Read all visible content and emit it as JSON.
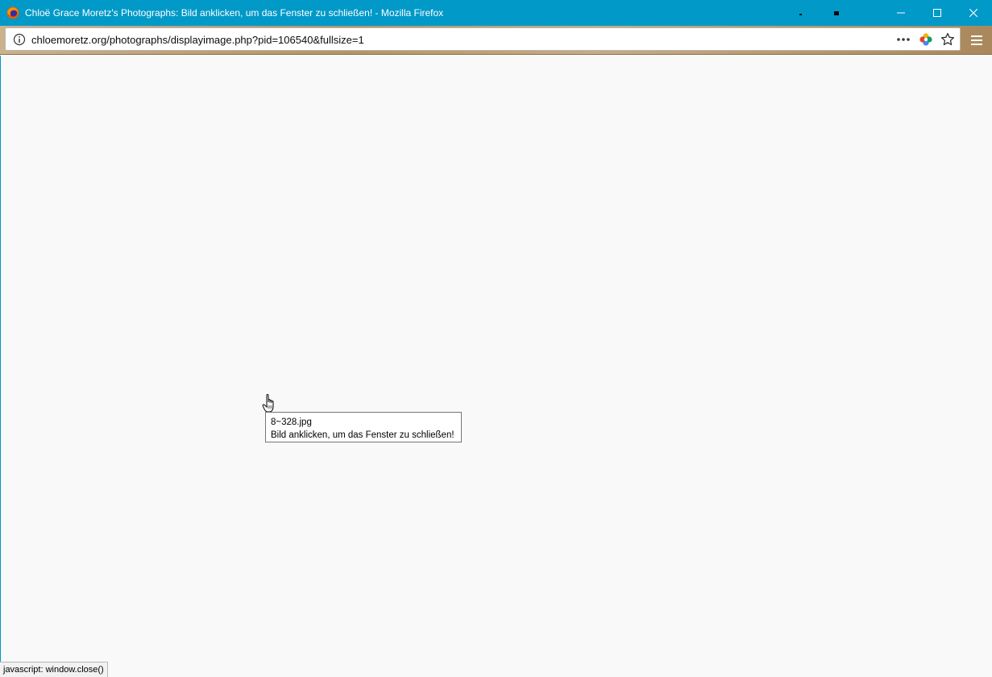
{
  "window": {
    "title": "Chloë Grace Moretz's Photographs: Bild anklicken, um das Fenster zu schließen! - Mozilla Firefox",
    "app_icon": "firefox-icon",
    "controls": [
      "minimize-icon",
      "maximize-icon",
      "close-icon"
    ]
  },
  "navbar": {
    "url": "chloemoretz.org/photographs/displayimage.php?pid=106540&fullsize=1",
    "icons": [
      "info-icon",
      "more-dots-icon",
      "extension-icon",
      "bookmark-star-icon",
      "hamburger-menu-icon"
    ]
  },
  "content": {
    "tooltip": {
      "line1": "8~328.jpg",
      "line2": "Bild anklicken, um das Fenster zu schließen!"
    }
  },
  "statusbar": {
    "text": "javascript: window.close()"
  },
  "colors": {
    "titlebar": "#0099c8",
    "page_background": "#f9f9f9"
  }
}
